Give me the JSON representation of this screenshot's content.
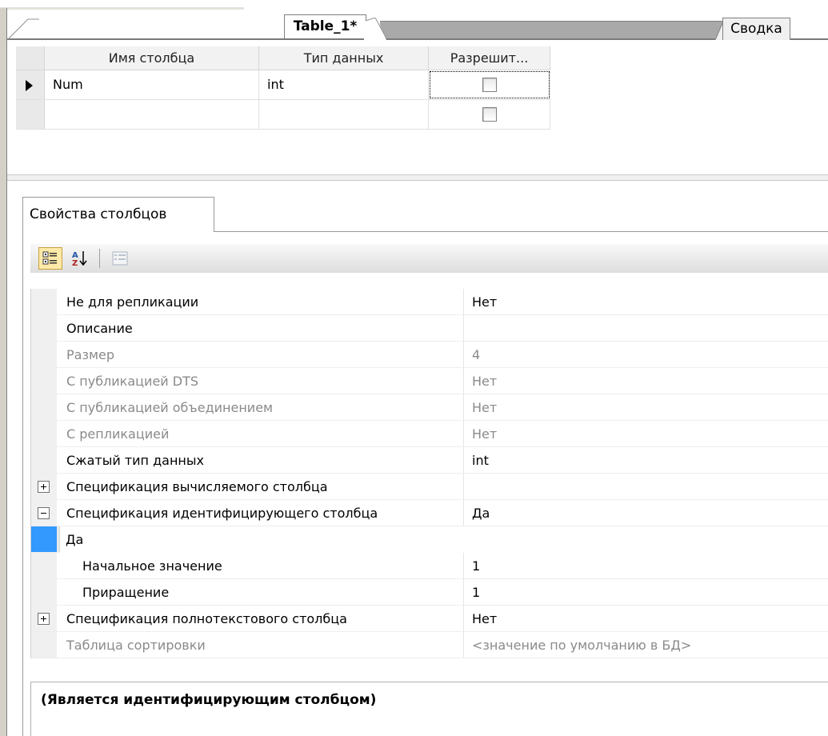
{
  "tabs": {
    "active": "Table_1*",
    "summary": "Сводка"
  },
  "design_grid": {
    "headers": [
      "Имя столбца",
      "Тип данных",
      "Разрешит..."
    ],
    "rows": [
      {
        "name": "Num",
        "type": "int",
        "allow_nulls": false
      },
      {
        "name": "",
        "type": "",
        "allow_nulls": false
      }
    ]
  },
  "properties_tab": {
    "label": "Свойства столбцов"
  },
  "toolbar": {
    "buttons": [
      "categorized-icon",
      "alphabetical-icon",
      "property-pages-icon"
    ]
  },
  "properties": [
    {
      "name": "Не для репликации",
      "value": "Нет",
      "state": "normal"
    },
    {
      "name": "Описание",
      "value": "",
      "state": "normal"
    },
    {
      "name": "Размер",
      "value": "4",
      "state": "dim"
    },
    {
      "name": "С публикацией DTS",
      "value": "Нет",
      "state": "dim"
    },
    {
      "name": "С публикацией объединением",
      "value": "Нет",
      "state": "dim"
    },
    {
      "name": "С репликацией",
      "value": "Нет",
      "state": "dim"
    },
    {
      "name": "Сжатый тип данных",
      "value": "int",
      "state": "normal"
    },
    {
      "name": "Спецификация вычисляемого столбца",
      "value": "",
      "state": "normal",
      "expander": "plus"
    },
    {
      "name": "Спецификация идентифицирующего столбца",
      "value": "Да",
      "state": "normal",
      "expander": "minus"
    },
    {
      "name": "(Является идентифицирующим столбцом)",
      "value": "Да",
      "state": "selected",
      "child": true
    },
    {
      "name": "Начальное значение",
      "value": "1",
      "state": "normal",
      "child": true
    },
    {
      "name": "Приращение",
      "value": "1",
      "state": "normal",
      "child": true
    },
    {
      "name": "Спецификация полнотекстового столбца",
      "value": "Нет",
      "state": "normal",
      "expander": "plus"
    },
    {
      "name": "Таблица сортировки",
      "value": "<значение по умолчанию в БД>",
      "state": "dim"
    }
  ],
  "description": {
    "title": "(Является идентифицирующим столбцом)"
  },
  "colors": {
    "selection": "#3399ff",
    "dim_text": "#8a8a8a",
    "toolbar_active": "#fde9a8"
  }
}
